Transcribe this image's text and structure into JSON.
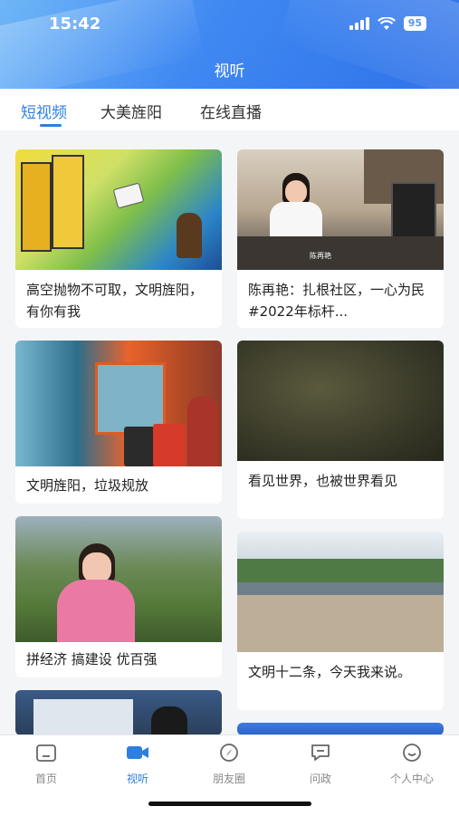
{
  "status_bar": {
    "time": "15:42",
    "battery": "95"
  },
  "page": {
    "title": "视听"
  },
  "tabs": [
    {
      "label": "短视频",
      "active": true
    },
    {
      "label": "大美旌阳",
      "active": false
    },
    {
      "label": "在线直播",
      "active": false
    }
  ],
  "videos": [
    {
      "title": "高空抛物不可取，文明旌阳，有你有我",
      "overlay_text": ""
    },
    {
      "title": "陈再艳：扎根社区，一心为民 #2022年标杆...",
      "overlay_text": "陈再艳"
    },
    {
      "title": "文明旌阳，垃圾规放",
      "overlay_text": ""
    },
    {
      "title": "看见世界，也被世界看见",
      "overlay_text": ""
    },
    {
      "title": "拼经济 搞建设 优百强",
      "overlay_text": ""
    },
    {
      "title": "文明十二条，今天我来说。",
      "overlay_text": ""
    }
  ],
  "bottom_nav": [
    {
      "label": "首页",
      "icon": "home-icon",
      "active": false
    },
    {
      "label": "视听",
      "icon": "video-camera-icon",
      "active": true
    },
    {
      "label": "朋友圈",
      "icon": "compass-icon",
      "active": false
    },
    {
      "label": "问政",
      "icon": "chat-icon",
      "active": false
    },
    {
      "label": "个人中心",
      "icon": "smiley-icon",
      "active": false
    }
  ],
  "colors": {
    "accent": "#2d7fe0",
    "header_start": "#6fb6f7",
    "header_end": "#2f72e8"
  }
}
